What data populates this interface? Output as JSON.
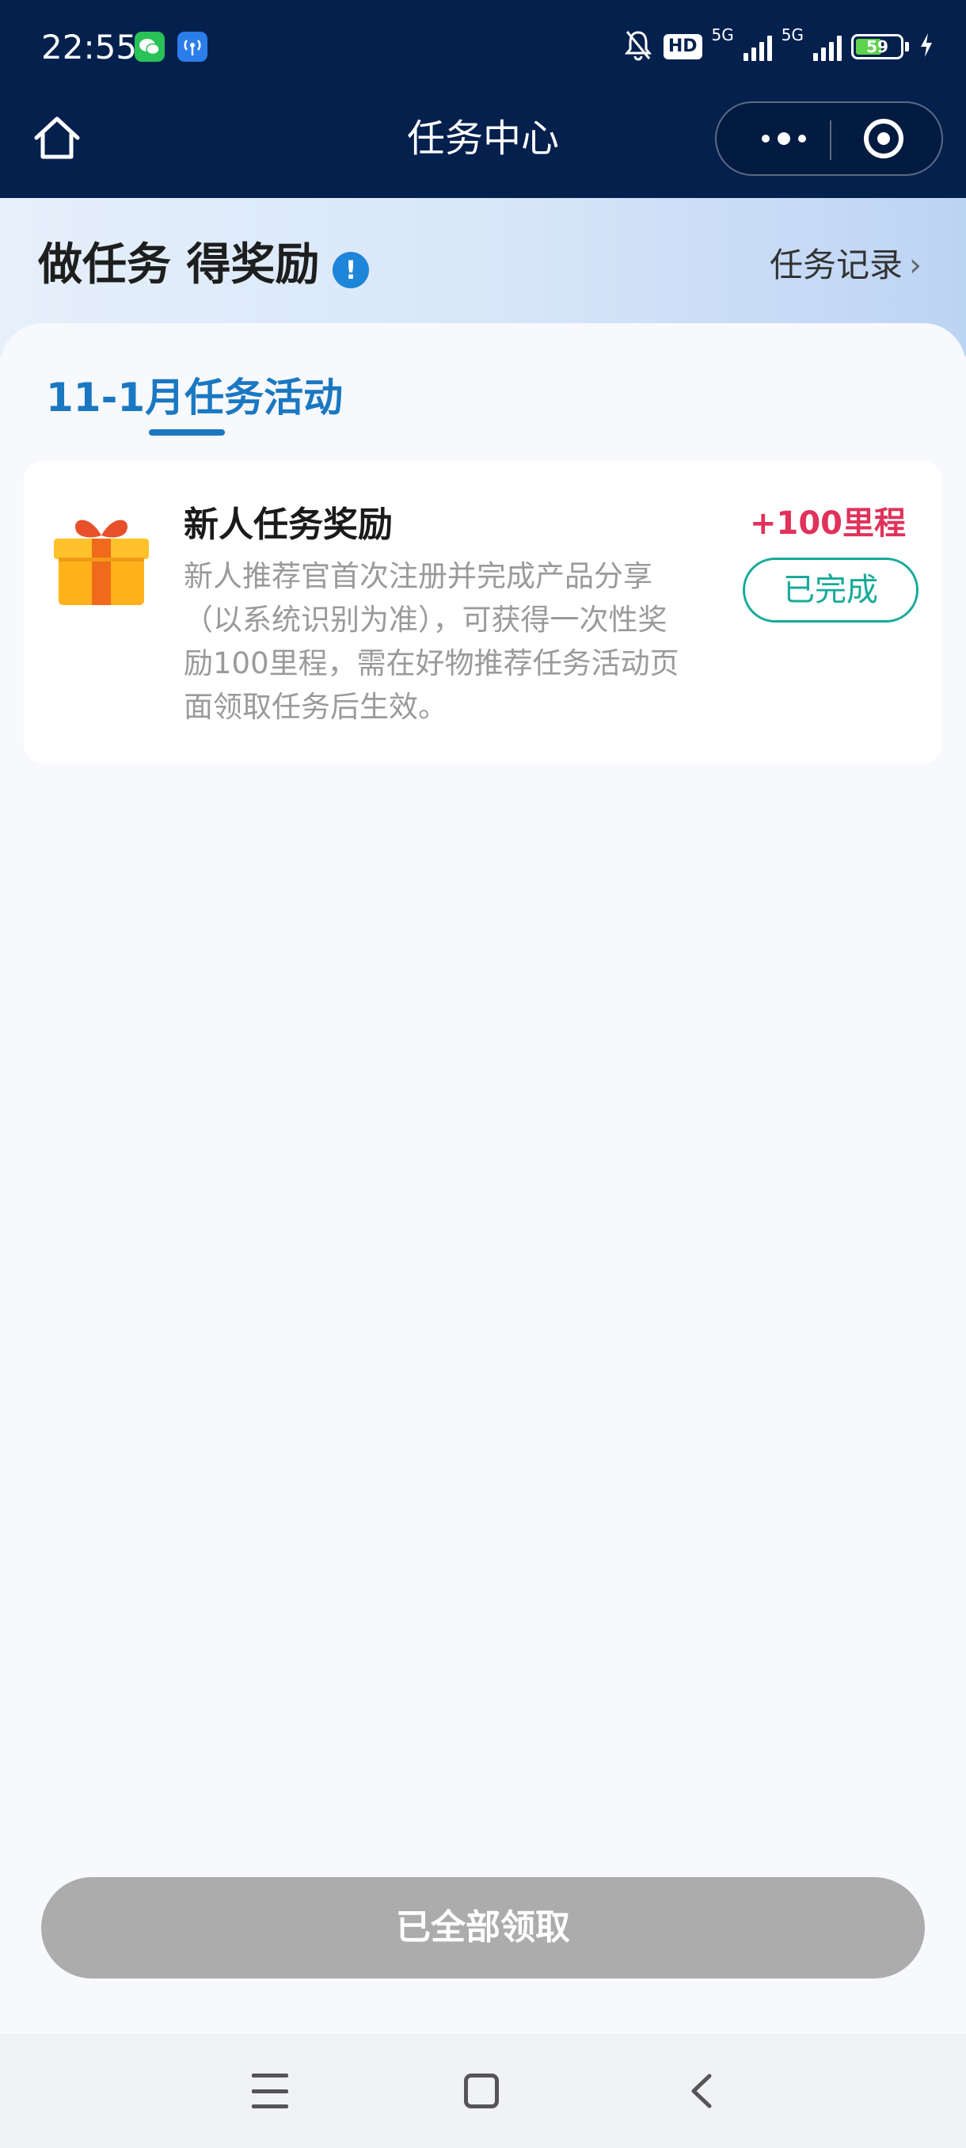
{
  "status_bar": {
    "time": "22:55",
    "hd_label": "HD",
    "net1": "5G",
    "net2": "5G",
    "battery": "59",
    "battery_level": 0.59,
    "icons": [
      "wechat-icon",
      "hotspot-icon",
      "bell-muted-icon",
      "signal-icon",
      "battery-icon",
      "charging-icon"
    ]
  },
  "nav_bar": {
    "title": "任务中心",
    "icons": [
      "home-icon",
      "more-icon",
      "target-icon"
    ]
  },
  "header": {
    "headline": "做任务 得奖励",
    "info_icon": "!",
    "records_link": "任务记录",
    "records_chevron": "›"
  },
  "tabs": [
    {
      "label": "11-1月任务活动",
      "active": true
    }
  ],
  "tasks": [
    {
      "title": "新人任务奖励",
      "description": "新人推荐官首次注册并完成产品分享（以系统识别为准），可获得一次性奖励100里程，需在好物推荐任务活动页面领取任务后生效。",
      "reward": "+100里程",
      "status_button": "已完成",
      "icon": "gift-icon"
    }
  ],
  "footer": {
    "claim_all_label": "已全部领取"
  },
  "colors": {
    "nav_bg": "#04204d",
    "accent": "#1a78c2",
    "reward": "#e0325a",
    "done": "#17aa9a",
    "disabled_button": "#acacac"
  }
}
